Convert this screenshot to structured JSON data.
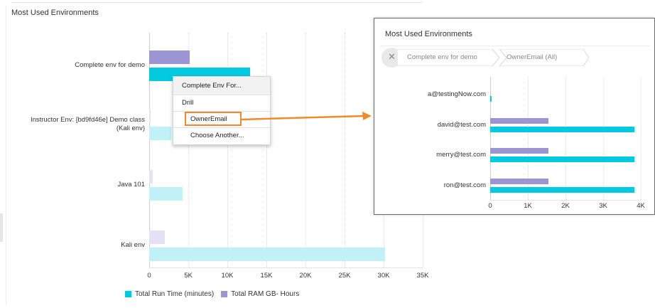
{
  "main_panel": {
    "title": "Most Used Environments"
  },
  "context_menu": {
    "header_label": "Complete Env For...",
    "section_label": "Drill",
    "items": [
      {
        "label": "OwnerEmail",
        "highlighted": true
      },
      {
        "label": "Choose Another..."
      }
    ]
  },
  "legend": {
    "items": [
      {
        "label": "Total Run Time (minutes)",
        "color": "#00c9e0"
      },
      {
        "label": "Total RAM GB- Hours",
        "color": "#9b95d4"
      }
    ]
  },
  "inset_panel": {
    "title": "Most Used Environments",
    "close_icon": "close-icon",
    "breadcrumb": [
      "Complete env for demo",
      "OwnerEmail (All)"
    ]
  },
  "arrow_color": "#f08a2c",
  "chart_data": [
    {
      "type": "bar",
      "orientation": "horizontal",
      "categories": [
        "Complete env for demo",
        "Instructor Env: [bd9fd46e] Demo class\n(Kali env)",
        "Java 101",
        "Kali env"
      ],
      "x_ticks": [
        "0",
        "5K",
        "10K",
        "15K",
        "20K",
        "25K",
        "30K",
        "35K"
      ],
      "xlim": [
        0,
        35000
      ],
      "grid": true,
      "legend_position": "bottom-left",
      "series": [
        {
          "name": "Total RAM GB- Hours",
          "color": "#9b95d4",
          "values": [
            5200,
            150,
            450,
            2000
          ]
        },
        {
          "name": "Total Run Time (minutes)",
          "color": "#00c9e0",
          "values": [
            12900,
            2800,
            4300,
            30200
          ]
        }
      ],
      "highlighted_category": "Complete env for demo"
    },
    {
      "type": "bar",
      "orientation": "horizontal",
      "categories": [
        "a@testingNow.com",
        "david@test.com",
        "merry@test.com",
        "ron@test.com"
      ],
      "x_ticks": [
        "0",
        "1K",
        "2K",
        "3K",
        "4K"
      ],
      "xlim": [
        0,
        4500
      ],
      "grid": true,
      "series": [
        {
          "name": "Total RAM GB- Hours",
          "color": "#9b95d4",
          "values": [
            0,
            1750,
            1750,
            1750
          ]
        },
        {
          "name": "Total Run Time (minutes)",
          "color": "#00c9e0",
          "values": [
            30,
            4300,
            4300,
            4300
          ]
        }
      ]
    }
  ]
}
